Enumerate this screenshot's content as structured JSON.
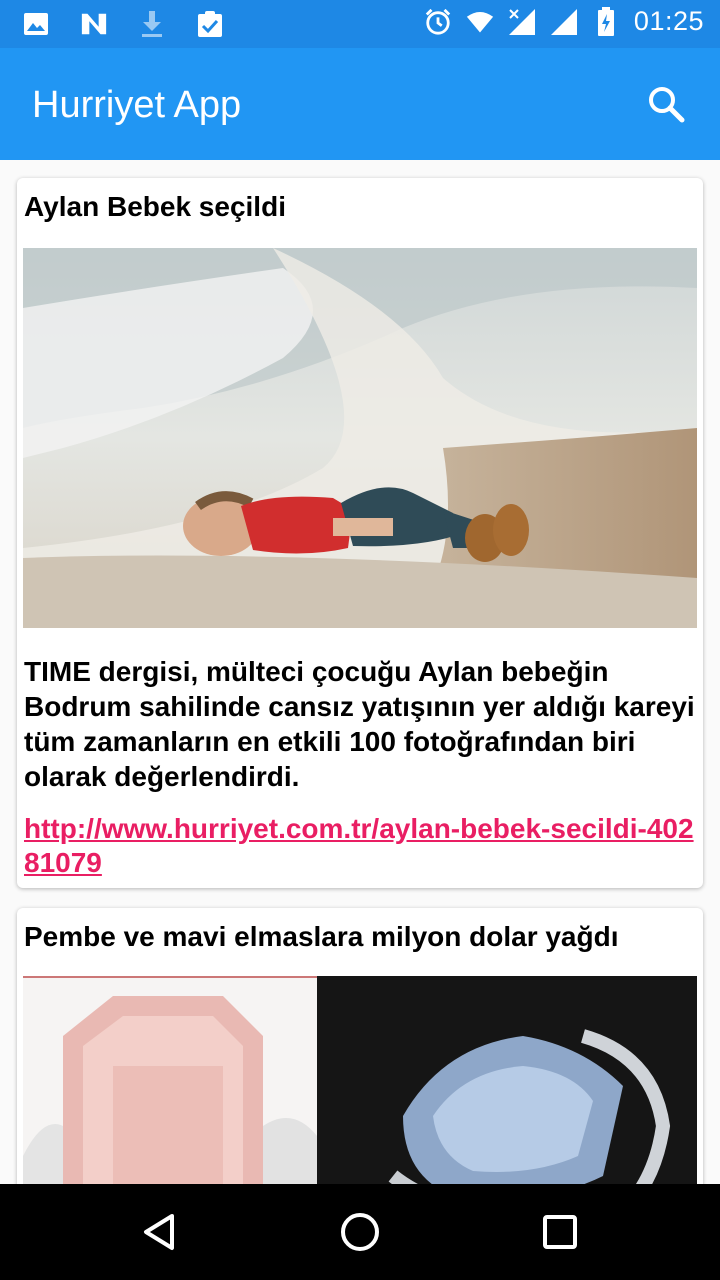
{
  "status_bar": {
    "time": "01:25",
    "left_icons": [
      "image-icon",
      "n-app-icon",
      "download-icon",
      "clipboard-check-icon"
    ],
    "right_icons": [
      "alarm-icon",
      "wifi-icon",
      "signal-off-icon",
      "signal-icon",
      "battery-charging-icon"
    ]
  },
  "app_bar": {
    "title": "Hurriyet App",
    "search_icon": "search-icon"
  },
  "colors": {
    "status_bar": "#1e88e5",
    "app_bar": "#2196f3",
    "link": "#e91e63",
    "nav_bar": "#000000"
  },
  "articles": [
    {
      "title": "Aylan Bebek seçildi",
      "image": "photo of child lying on beach shoreline",
      "description": "TIME dergisi, mülteci çocuğu Aylan bebeğin Bodrum sahilinde cansız yatışının yer aldığı kareyi tüm zamanların en etkili 100 fotoğrafından biri olarak değerlendirdi.",
      "link": "http://www.hurriyet.com.tr/aylan-bebek-secildi-40281079"
    },
    {
      "title": "Pembe ve mavi elmaslara milyon dolar yağdı",
      "image": "pink diamond ring and blue diamond ring"
    }
  ],
  "nav_bar": {
    "back_icon": "back-triangle-icon",
    "home_icon": "home-circle-icon",
    "recents_icon": "recents-square-icon"
  }
}
